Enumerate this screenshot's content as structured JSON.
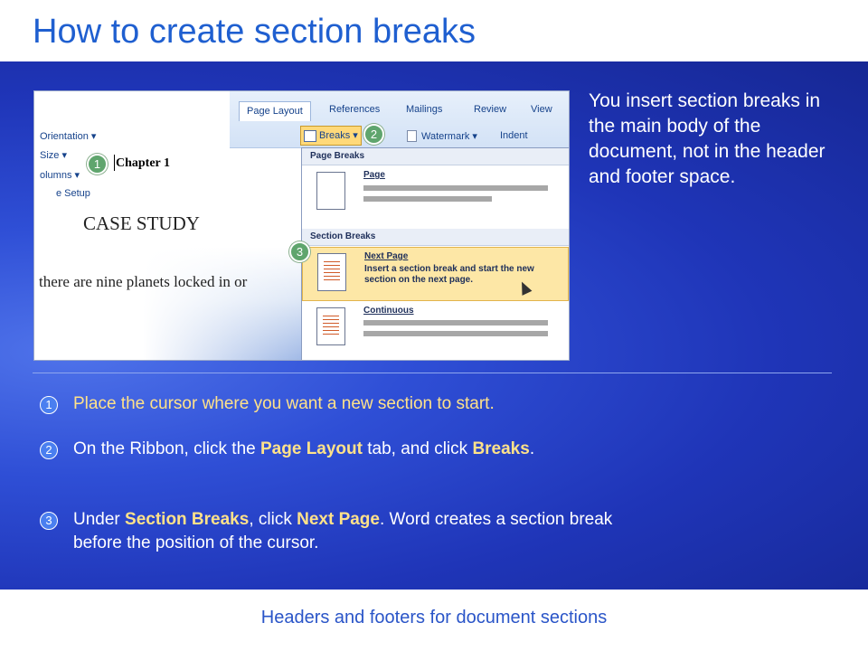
{
  "title": "How to create section breaks",
  "footer": "Headers and footers for document sections",
  "intro": "You insert section breaks in the main body of the document, not in the header and footer space.",
  "steps": [
    {
      "num": "1",
      "text": "Place the cursor where you want a new section to start."
    },
    {
      "num": "2",
      "pre": "On the Ribbon, click the ",
      "b1": "Page Layout",
      "mid": " tab, and click ",
      "b2": "Breaks",
      "post": "."
    },
    {
      "num": "3",
      "pre": "Under ",
      "b1": "Section Breaks",
      "mid": ", click ",
      "b2": "Next Page",
      "post": ". Word creates a section break before the position of the cursor."
    }
  ],
  "screenshot": {
    "doc": {
      "chapter": "Chapter 1",
      "case": "CASE STUDY",
      "planets": "there are nine planets locked in or"
    },
    "callouts": [
      "1",
      "2",
      "3"
    ],
    "tabs": [
      "Page Layout",
      "References",
      "Mailings",
      "Review",
      "View"
    ],
    "ribbon": {
      "orientation": "Orientation ▾",
      "size": "Size ▾",
      "columns": "olumns ▾",
      "setup": "e Setup",
      "breaks": "Breaks ▾",
      "watermark": "Watermark ▾",
      "indent": "Indent"
    },
    "menu": {
      "page_breaks": "Page Breaks",
      "section_breaks": "Section Breaks",
      "page": "Page",
      "next_page": "Next Page",
      "next_page_desc": "Insert a section break and start the new section on the next page.",
      "continuous": "Continuous"
    }
  }
}
